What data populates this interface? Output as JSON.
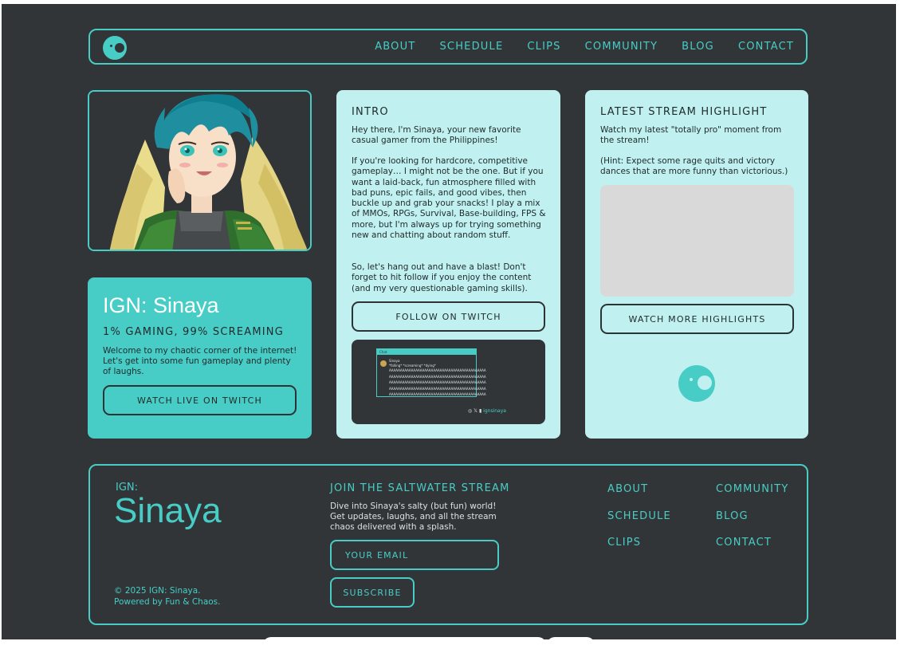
{
  "nav": {
    "links": [
      "ABOUT",
      "SCHEDULE",
      "CLIPS",
      "COMMUNITY",
      "BLOG",
      "CONTACT"
    ]
  },
  "profile": {
    "title": "IGN: Sinaya",
    "tagline": "1% GAMING, 99% SCREAMING",
    "description": "Welcome to my chaotic corner of the internet! Let's get into some fun gameplay and plenty of laughs.",
    "button": "WATCH LIVE ON TWITCH"
  },
  "intro": {
    "heading": "INTRO",
    "p1": "Hey there, I'm Sinaya, your new favorite casual gamer from the Philippines!",
    "p2": "If you're looking for hardcore, competitive gameplay… I might not be the one. But if you want a laid-back, fun atmosphere filled with bad puns, epic fails, and good vibes, then buckle up and grab your snacks! I play a mix of MMOs, RPGs, Survival, Base-building, FPS & more, but I'm always up for trying something new and chatting about random stuff.",
    "p3": "So, let's hang out and have a blast! Don't forget to hit follow if you enjoy the content (and my very questionable gaming skills).",
    "button": "FOLLOW ON TWITCH",
    "clip": {
      "chat_title": "Chat",
      "user": "Sinaya",
      "message": "*falling* *screaming* *dying*",
      "scream_lines": [
        "AAAAAAAAAAAAAAAAAAAAAAAAAAAAAAAAAAAAAAAAAAAA",
        "AAAAAAAAAAAAAAAAAAAAAAAAAAAAAAAAAAAAAAAAAAAA",
        "AAAAAAAAAAAAAAAAAAAAAAAAAAAAAAAAAAAAAAAAAAAA",
        "AAAAAAAAAAAAAAAAAAAAAAAAAAAAAAAAAAAAAAAAAAAA",
        "AAAAAAAAAAAAAAAAAAAAAAAAAAAAAAAAAAAAAAAAAAAA"
      ],
      "social_handle": "ignsinaya"
    }
  },
  "highlight": {
    "heading": "LATEST STREAM HIGHLIGHT",
    "p1": "Watch my latest \"totally pro\" moment from the stream!",
    "p2": "(Hint: Expect some rage quits and victory dances that are more funny than victorious.)",
    "button": "WATCH MORE HIGHLIGHTS"
  },
  "footer": {
    "ign_label": "IGN:",
    "name": "Sinaya",
    "copyright": "© 2025 IGN: Sinaya.",
    "powered": "Powered by Fun & Chaos.",
    "newsletter_heading": "JOIN THE SALTWATER STREAM",
    "newsletter_desc": "Dive into Sinaya's salty (but fun) world! Get updates, laughs, and all the stream chaos delivered with a splash.",
    "email_placeholder": "YOUR EMAIL",
    "subscribe": "SUBSCRIBE",
    "links_col1": [
      "ABOUT",
      "SCHEDULE",
      "CLIPS"
    ],
    "links_col2": [
      "COMMUNITY",
      "BLOG",
      "CONTACT"
    ]
  },
  "colors": {
    "background": "#323538",
    "accent": "#48cdc6",
    "card_light": "#c0f0ef"
  }
}
